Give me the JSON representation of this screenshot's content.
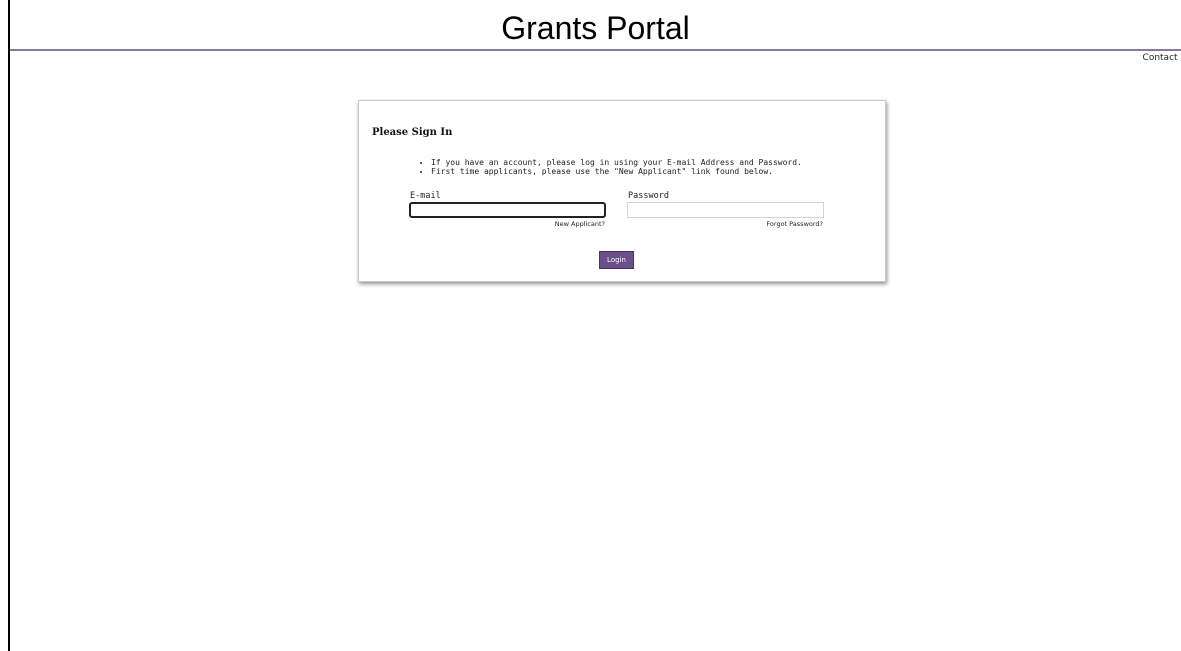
{
  "header": {
    "title": "Grants Portal",
    "contact_link": "Contact U"
  },
  "signin": {
    "title": "Please Sign In",
    "instructions": [
      "If you have an account, please log in using your E-mail Address and Password.",
      "First time applicants, please use the \"New Applicant\" link found below."
    ],
    "email_label": "E-mail",
    "email_value": "",
    "password_label": "Password",
    "password_value": "",
    "new_applicant_link": "New Applicant?",
    "forgot_password_link": "Forgot Password?",
    "login_button": "Login"
  },
  "colors": {
    "accent": "#6b4f8a",
    "header_rule": "#8a7898"
  }
}
